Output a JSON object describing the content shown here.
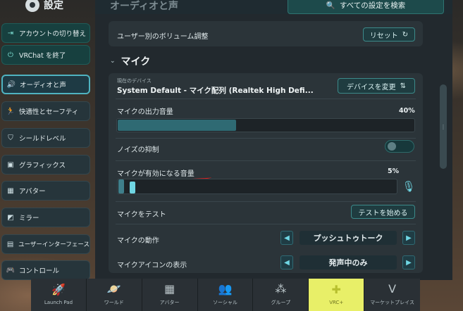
{
  "settings_title": "設定",
  "page_heading": "オーディオと声",
  "search_all": "すべての設定を検索",
  "sidebar": {
    "actions": [
      {
        "label": "アカウントの切り替え",
        "icon": "account-switch-icon"
      },
      {
        "label": "VRChat を終了",
        "icon": "power-icon"
      }
    ],
    "items": [
      {
        "label": "オーディオと声",
        "icon": "speaker-icon",
        "active": true
      },
      {
        "label": "快適性とセーフティ",
        "icon": "person-run-icon"
      },
      {
        "label": "シールドレベル",
        "icon": "shield-icon"
      },
      {
        "label": "グラフィックス",
        "icon": "image-icon"
      },
      {
        "label": "アバター",
        "icon": "avatar-icon"
      },
      {
        "label": "ミラー",
        "icon": "mirror-icon"
      },
      {
        "label": "ユーザーインターフェース",
        "icon": "ui-icon"
      },
      {
        "label": "コントロール",
        "icon": "gamepad-icon"
      }
    ]
  },
  "per_user_volume": {
    "label": "ユーザー別のボリューム調整",
    "reset_label": "リセット"
  },
  "mic_section": {
    "title": "マイク",
    "current_device_caption": "現在のデバイス",
    "device_name": "System Default - マイク配列 (Realtek High Defi...",
    "change_device_label": "デバイスを変更",
    "output_volume": {
      "label": "マイクの出力音量",
      "value_text": "40%",
      "value": 0.4
    },
    "noise_suppression": {
      "label": "ノイズの抑制",
      "on": false
    },
    "activation_threshold": {
      "label": "マイクが有効になる音量",
      "value_text": "5%",
      "value": 0.05
    },
    "test": {
      "label": "マイクをテスト",
      "button_label": "テストを始める"
    },
    "behavior": {
      "label": "マイクの動作",
      "value": "プッシュトゥトーク"
    },
    "icon_display": {
      "label": "マイクアイコンの表示",
      "value": "発声中のみ"
    }
  },
  "dock": [
    {
      "label": "Launch Pad",
      "icon": "rocket-icon"
    },
    {
      "label": "ワールド",
      "icon": "planet-icon"
    },
    {
      "label": "アバター",
      "icon": "avatar-card-icon"
    },
    {
      "label": "ソーシャル",
      "icon": "people-icon"
    },
    {
      "label": "グループ",
      "icon": "group-icon"
    },
    {
      "label": "VRC+",
      "icon": "vrcplus-icon",
      "highlight": true
    },
    {
      "label": "マーケットプレイス",
      "icon": "marketplace-icon"
    }
  ],
  "colors": {
    "accent": "#4fb3c0",
    "annotation_red": "#e01a1a",
    "vrcplus": "#e8ef68"
  }
}
